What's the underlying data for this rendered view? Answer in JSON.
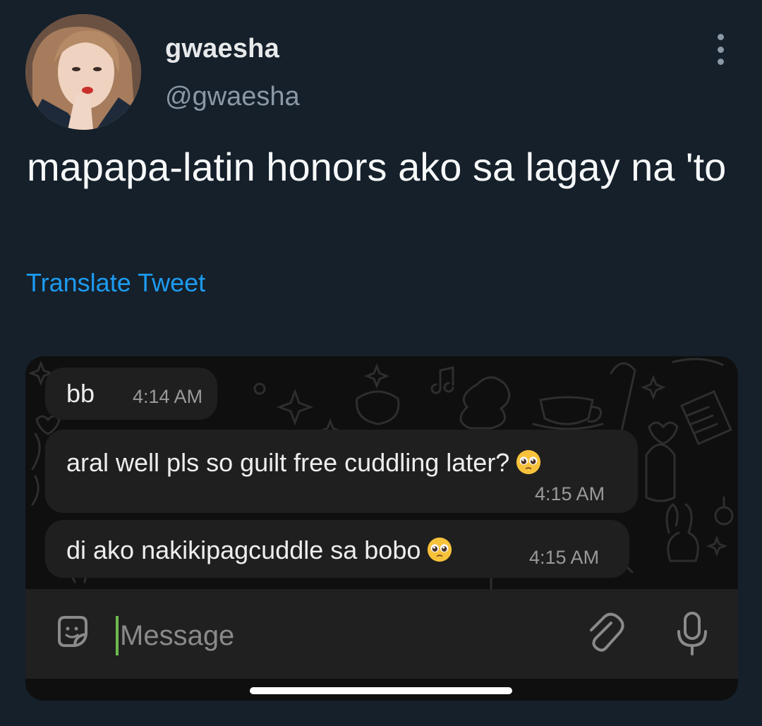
{
  "author": {
    "display_name": "gwaesha",
    "handle": "@gwaesha"
  },
  "tweet": {
    "text": "mapapa-latin honors ako sa lagay na 'to",
    "translate_label": "Translate Tweet"
  },
  "chat": {
    "messages": [
      {
        "text": "bb",
        "time": "4:14 AM"
      },
      {
        "text": "aral well pls so guilt free cuddling later?",
        "time": "4:15 AM",
        "emoji": "pleading-face"
      },
      {
        "text": "di ako nakikipagcuddle sa bobo",
        "time": "4:15 AM",
        "emoji": "pleading-face"
      }
    ],
    "composer": {
      "placeholder": "Message"
    }
  },
  "colors": {
    "background": "#15202b",
    "accent": "#1d9bf0",
    "bubble": "#1f1f1f",
    "cursor": "#6dbb4f"
  }
}
